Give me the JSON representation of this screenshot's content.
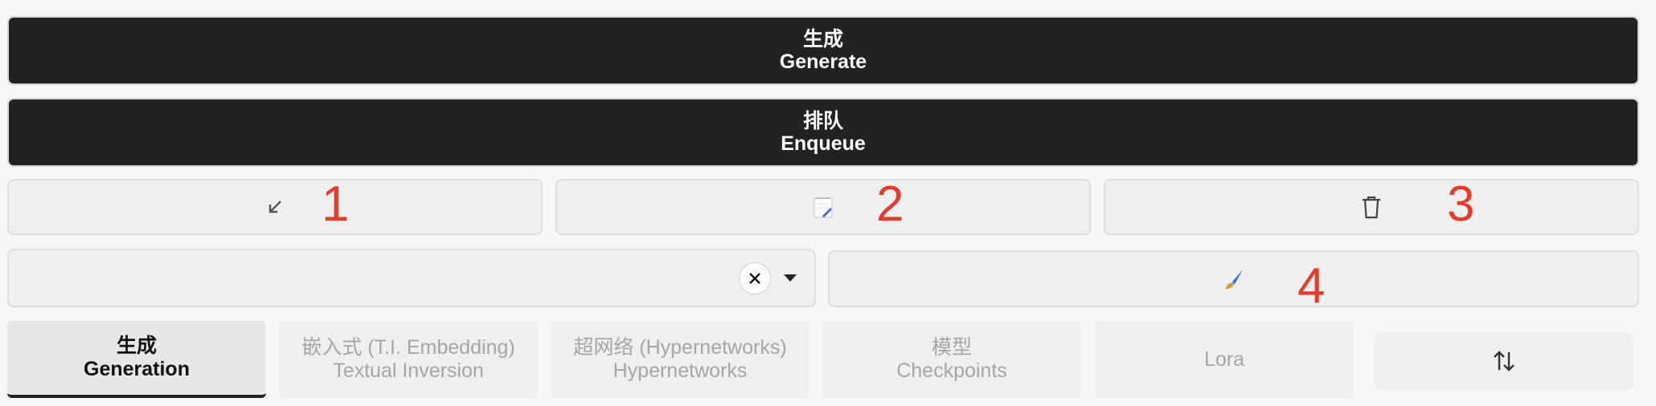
{
  "generate_button": {
    "line1": "生成",
    "line2": "Generate"
  },
  "enqueue_button": {
    "line1": "排队",
    "line2": "Enqueue"
  },
  "annotations": [
    "1",
    "2",
    "3",
    "4"
  ],
  "toolbar": {
    "paste_icon": "arrow-down-left-icon",
    "notepad_icon": "notepad-icon",
    "trash_icon": "trash-icon",
    "paintbrush_icon": "paintbrush-icon"
  },
  "style_dropdown": {
    "value": ""
  },
  "tabs": [
    {
      "line1": "生成",
      "line2": "Generation"
    },
    {
      "line1": "嵌入式 (T.I. Embedding)",
      "line2": "Textual Inversion"
    },
    {
      "line1": "超网络 (Hypernetworks)",
      "line2": "Hypernetworks"
    },
    {
      "line1": "模型",
      "line2": "Checkpoints"
    },
    {
      "line1": "Lora",
      "line2": ""
    }
  ],
  "colors": {
    "primary_button": "#222222",
    "annotation": "#e53b2c"
  }
}
